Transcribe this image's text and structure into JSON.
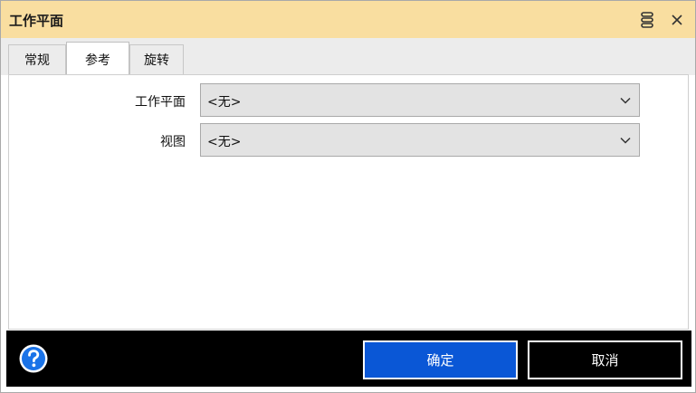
{
  "window": {
    "title": "工作平面"
  },
  "tabs": [
    {
      "label": "常规",
      "active": false
    },
    {
      "label": "参考",
      "active": true
    },
    {
      "label": "旋转",
      "active": false
    }
  ],
  "form": {
    "workplane": {
      "label": "工作平面",
      "value": "<无>"
    },
    "view": {
      "label": "视图",
      "value": "<无>"
    }
  },
  "footer": {
    "ok_label": "确定",
    "cancel_label": "取消"
  },
  "icons": {
    "menu": "menu-icon",
    "close": "close-icon",
    "help": "help-icon",
    "dropdown": "chevron-down-icon"
  },
  "colors": {
    "titlebar": "#f9dea0",
    "ok_button": "#0a57d6",
    "footer": "#000000",
    "help_icon": "#1a73e8"
  }
}
